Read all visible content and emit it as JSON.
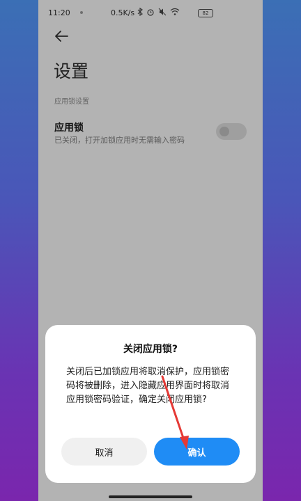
{
  "status_bar": {
    "time": "11:20",
    "network_speed": "0.5K/s",
    "battery": "82",
    "icons": [
      "bluetooth-icon",
      "alarm-icon",
      "mute-icon",
      "wifi-icon",
      "battery-icon"
    ]
  },
  "header": {
    "title": "设置"
  },
  "section": {
    "label": "应用锁设置"
  },
  "setting": {
    "title": "应用锁",
    "description": "已关闭，打开加锁应用时无需输入密码",
    "toggle_on": false
  },
  "dialog": {
    "title": "关闭应用锁?",
    "message": "关闭后已加锁应用将取消保护，应用锁密码将被删除，进入隐藏应用界面时将取消应用锁密码验证，确定关闭应用锁?",
    "cancel_label": "取消",
    "confirm_label": "确认"
  },
  "colors": {
    "accent": "#1f8cf5",
    "annotation": "#e53935",
    "dim_overlay": "#b3b3b3"
  }
}
